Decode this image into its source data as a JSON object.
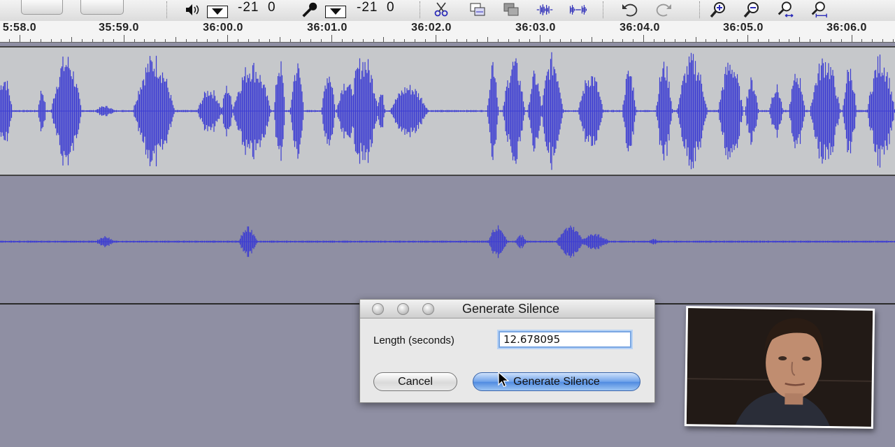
{
  "toolbar": {
    "playback_level": "-21",
    "playback_zero": "0",
    "record_level": "-21",
    "record_zero": "0",
    "icons": [
      "speaker-icon",
      "microphone-icon",
      "scissors-icon",
      "copy-icon",
      "paste-icon",
      "trim-icon",
      "silence-icon",
      "undo-icon",
      "redo-icon",
      "zoom-in-icon",
      "zoom-out-icon",
      "fit-selection-icon",
      "fit-project-icon"
    ]
  },
  "ruler": {
    "labels": [
      "5:58.0",
      "35:59.0",
      "36:00.0",
      "36:01.0",
      "36:02.0",
      "36:03.0",
      "36:04.0",
      "36:05.0",
      "36:06.0"
    ]
  },
  "colors": {
    "waveform": "#3c3cd2",
    "track_bg": "#c6c8cb",
    "workspace_bg": "#8f8fa3",
    "default_button": "#6fa2ea"
  },
  "dialog": {
    "title": "Generate Silence",
    "length_label": "Length (seconds)",
    "length_value": "12.678095",
    "cancel_label": "Cancel",
    "generate_label": "Generate Silence"
  }
}
